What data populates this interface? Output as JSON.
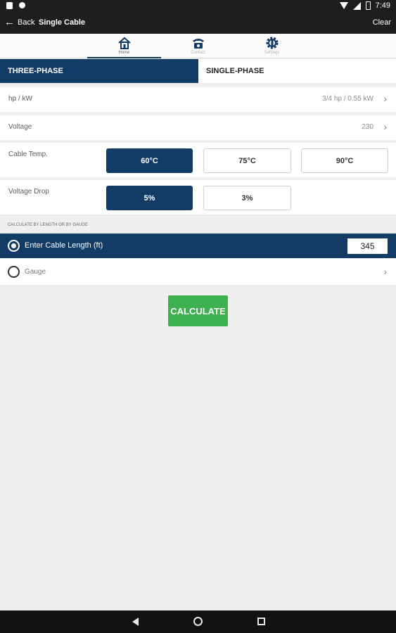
{
  "status_bar": {
    "time": "7:49"
  },
  "app_bar": {
    "back_label": "Back",
    "title": "Single Cable",
    "clear_label": "Clear"
  },
  "nav_tabs": [
    {
      "label": "Home",
      "icon": "home-icon",
      "active": true
    },
    {
      "label": "Contact",
      "icon": "phone-icon",
      "active": false
    },
    {
      "label": "Settings",
      "icon": "gear-icon",
      "active": false
    }
  ],
  "phase_tabs": [
    {
      "label": "THREE-PHASE",
      "selected": true
    },
    {
      "label": "SINGLE-PHASE",
      "selected": false
    }
  ],
  "hp_row": {
    "label": "hp / kW",
    "value": "3/4 hp / 0.55 kW"
  },
  "voltage_row": {
    "label": "Voltage",
    "value": "230"
  },
  "cable_temp": {
    "label": "Cable Temp.",
    "options": [
      "60°C",
      "75°C",
      "90°C"
    ],
    "selected": "60°C"
  },
  "voltage_drop": {
    "label": "Voltage Drop",
    "options": [
      "5%",
      "3%"
    ],
    "selected": "5%"
  },
  "calc_section": {
    "header": "CALCULATE BY LENGTH OR BY GAUGE",
    "length_label": "Enter Cable Length (ft)",
    "length_value": "345",
    "gauge_label": "Gauge"
  },
  "calculate_label": "CALCULATE",
  "colors": {
    "primary": "#123c66",
    "accent_green": "#3eb04f",
    "bar_dark": "#1e1e1e"
  }
}
